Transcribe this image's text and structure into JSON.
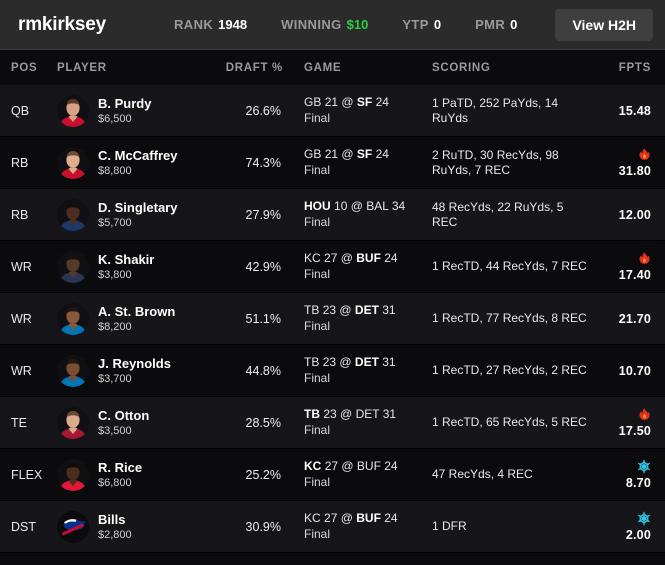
{
  "header": {
    "username": "rmkirksey",
    "stats": [
      {
        "label": "RANK",
        "value": "1948",
        "money": false
      },
      {
        "label": "WINNING",
        "value": "$10",
        "money": true
      },
      {
        "label": "YTP",
        "value": "0",
        "money": false
      },
      {
        "label": "PMR",
        "value": "0",
        "money": false
      }
    ],
    "h2h_button": "View H2H"
  },
  "columns": {
    "pos": "POS",
    "player": "PLAYER",
    "draft": "DRAFT %",
    "game": "GAME",
    "scoring": "SCORING",
    "fpts": "FPTS"
  },
  "colors": {
    "money_green": "#2fcc40",
    "flame": "#e03020",
    "snowflake": "#32c8e6",
    "row_alt": "#16161a",
    "row_base": "#0b0b0d",
    "topbar": "#2b2b2b"
  },
  "rows": [
    {
      "pos": "QB",
      "name": "B. Purdy",
      "salary": "$6,500",
      "draft_pct": "26.6%",
      "game_away": "GB",
      "game_away_score": "21",
      "game_home": "SF",
      "game_home_score": "24",
      "game_bold_side": "home",
      "game_status": "Final",
      "scoring": "1 PaTD, 252 PaYds, 14 RuYds",
      "fpts": "15.48",
      "streak": "none",
      "avatar_type": "headshot",
      "skin": "#d9a186",
      "hair": "#5a3a28",
      "jersey": "#c8102e"
    },
    {
      "pos": "RB",
      "name": "C. McCaffrey",
      "salary": "$8,800",
      "draft_pct": "74.3%",
      "game_away": "GB",
      "game_away_score": "21",
      "game_home": "SF",
      "game_home_score": "24",
      "game_bold_side": "home",
      "game_status": "Final",
      "scoring": "2 RuTD, 30 RecYds, 98 RuYds, 7 REC",
      "fpts": "31.80",
      "streak": "hot",
      "avatar_type": "headshot",
      "skin": "#e0ad8e",
      "hair": "#6b4b33",
      "jersey": "#c8102e"
    },
    {
      "pos": "RB",
      "name": "D. Singletary",
      "salary": "$5,700",
      "draft_pct": "27.9%",
      "game_away": "HOU",
      "game_away_score": "10",
      "game_home": "BAL",
      "game_home_score": "34",
      "game_bold_side": "away",
      "game_status": "Final",
      "scoring": "48 RecYds, 22 RuYds, 5 REC",
      "fpts": "12.00",
      "streak": "none",
      "avatar_type": "headshot",
      "skin": "#4a2e20",
      "hair": "#140d09",
      "jersey": "#1b3a6b"
    },
    {
      "pos": "WR",
      "name": "K. Shakir",
      "salary": "$3,800",
      "draft_pct": "42.9%",
      "game_away": "KC",
      "game_away_score": "27",
      "game_home": "BUF",
      "game_home_score": "24",
      "game_bold_side": "home",
      "game_status": "Final",
      "scoring": "1 RecTD, 44 RecYds, 7 REC",
      "fpts": "17.40",
      "streak": "hot",
      "avatar_type": "headshot",
      "skin": "#55392a",
      "hair": "#17100b",
      "jersey": "#2a3550"
    },
    {
      "pos": "WR",
      "name": "A. St. Brown",
      "salary": "$8,200",
      "draft_pct": "51.1%",
      "game_away": "TB",
      "game_away_score": "23",
      "game_home": "DET",
      "game_home_score": "31",
      "game_bold_side": "home",
      "game_status": "Final",
      "scoring": "1 RecTD, 77 RecYds, 8 REC",
      "fpts": "21.70",
      "streak": "none",
      "avatar_type": "headshot",
      "skin": "#8a5a3c",
      "hair": "#201510",
      "jersey": "#0076b6"
    },
    {
      "pos": "WR",
      "name": "J. Reynolds",
      "salary": "$3,700",
      "draft_pct": "44.8%",
      "game_away": "TB",
      "game_away_score": "23",
      "game_home": "DET",
      "game_home_score": "31",
      "game_bold_side": "home",
      "game_status": "Final",
      "scoring": "1 RecTD, 27 RecYds, 2 REC",
      "fpts": "10.70",
      "streak": "none",
      "avatar_type": "headshot",
      "skin": "#7a4e34",
      "hair": "#241812",
      "jersey": "#0076b6"
    },
    {
      "pos": "TE",
      "name": "C. Otton",
      "salary": "$3,500",
      "draft_pct": "28.5%",
      "game_away": "TB",
      "game_away_score": "23",
      "game_home": "DET",
      "game_home_score": "31",
      "game_bold_side": "away",
      "game_status": "Final",
      "scoring": "1 RecTD, 65 RecYds, 5 REC",
      "fpts": "17.50",
      "streak": "hot",
      "avatar_type": "headshot",
      "skin": "#dba98c",
      "hair": "#6a4a32",
      "jersey": "#a71930"
    },
    {
      "pos": "FLEX",
      "name": "R. Rice",
      "salary": "$6,800",
      "draft_pct": "25.2%",
      "game_away": "KC",
      "game_away_score": "27",
      "game_home": "BUF",
      "game_home_score": "24",
      "game_bold_side": "away",
      "game_status": "Final",
      "scoring": "47 RecYds, 4 REC",
      "fpts": "8.70",
      "streak": "cold",
      "avatar_type": "headshot",
      "skin": "#4a2d1e",
      "hair": "#120c08",
      "jersey": "#e31837"
    },
    {
      "pos": "DST",
      "name": "Bills",
      "salary": "$2,800",
      "draft_pct": "30.9%",
      "game_away": "KC",
      "game_away_score": "27",
      "game_home": "BUF",
      "game_home_score": "24",
      "game_bold_side": "home",
      "game_status": "Final",
      "scoring": "1 DFR",
      "fpts": "2.00",
      "streak": "cold",
      "avatar_type": "team-logo",
      "skin": "",
      "hair": "",
      "jersey": "#00338d"
    }
  ]
}
